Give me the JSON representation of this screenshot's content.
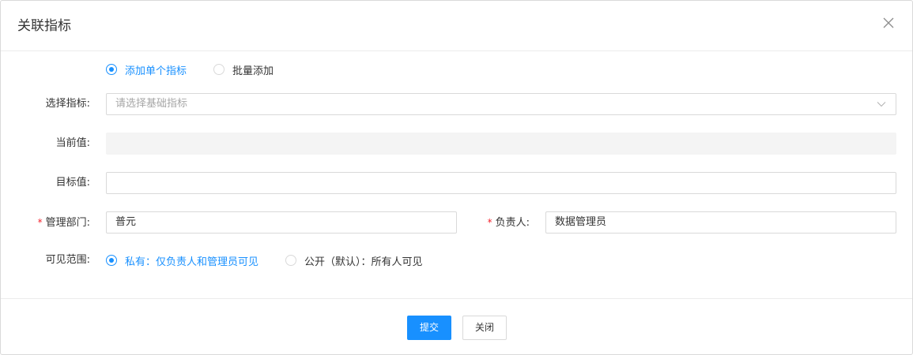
{
  "dialog": {
    "title": "关联指标",
    "close_icon": "close-icon"
  },
  "add_mode": {
    "options": [
      {
        "label": "添加单个指标",
        "checked": true
      },
      {
        "label": "批量添加",
        "checked": false
      }
    ]
  },
  "form": {
    "indicator": {
      "label": "选择指标:",
      "placeholder": "请选择基础指标"
    },
    "current_value": {
      "label": "当前值:",
      "value": ""
    },
    "target_value": {
      "label": "目标值:",
      "value": ""
    },
    "department": {
      "required_mark": "*",
      "label": "管理部门:",
      "value": "普元"
    },
    "owner": {
      "required_mark": "*",
      "label": "负责人:",
      "value": "数据管理员"
    },
    "visibility": {
      "label": "可见范围:",
      "options": [
        {
          "label": "私有：仅负责人和管理员可见",
          "checked": true
        },
        {
          "label": "公开（默认）：所有人可见",
          "checked": false
        }
      ]
    }
  },
  "footer": {
    "submit_label": "提交",
    "close_label": "关闭"
  },
  "colors": {
    "accent": "#1890ff",
    "required": "#f5222d",
    "border": "#d9d9d9",
    "disabled_bg": "#f4f4f4"
  }
}
